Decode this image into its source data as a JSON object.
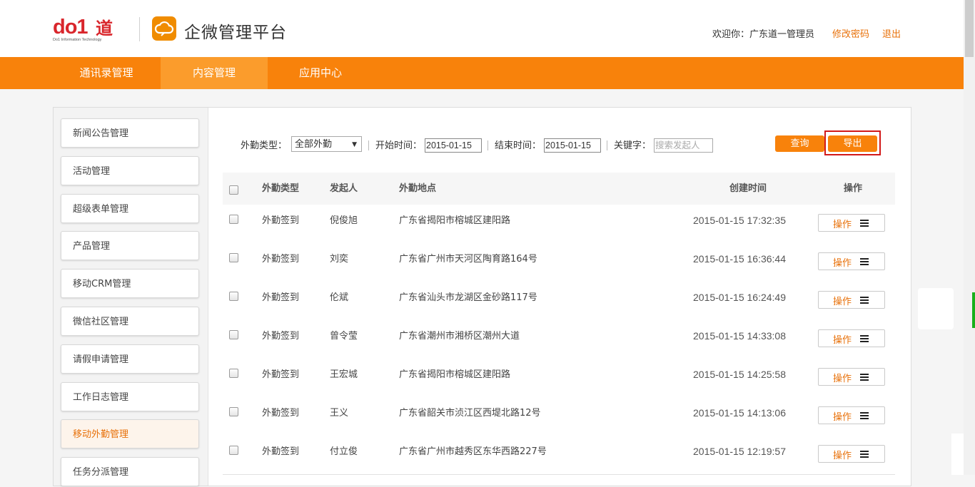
{
  "header": {
    "logo_text": "do1道",
    "logo_sub": "Do1 Information Technology",
    "app_title": "企微管理平台",
    "welcome": "欢迎你：广东道一管理员",
    "change_password": "修改密码",
    "logout": "退出"
  },
  "nav": {
    "items": [
      {
        "label": "通讯录管理"
      },
      {
        "label": "内容管理"
      },
      {
        "label": "应用中心"
      }
    ],
    "active_index": 1
  },
  "sidebar": {
    "items": [
      {
        "label": "新闻公告管理"
      },
      {
        "label": "活动管理"
      },
      {
        "label": "超级表单管理"
      },
      {
        "label": "产品管理"
      },
      {
        "label": "移动CRM管理"
      },
      {
        "label": "微信社区管理"
      },
      {
        "label": "请假申请管理"
      },
      {
        "label": "工作日志管理"
      },
      {
        "label": "移动外勤管理"
      },
      {
        "label": "任务分派管理"
      }
    ],
    "active_index": 8
  },
  "filters": {
    "type_label": "外勤类型：",
    "type_value": "全部外勤",
    "start_label": "开始时间：",
    "start_value": "2015-01-15",
    "end_label": "结束时间：",
    "end_value": "2015-01-15",
    "keyword_label": "关键字：",
    "keyword_placeholder": "搜索发起人",
    "query_button": "查询",
    "export_button": "导出"
  },
  "table": {
    "columns": [
      "外勤类型",
      "发起人",
      "外勤地点",
      "创建时间",
      "操作"
    ],
    "rows": [
      {
        "type": "外勤签到",
        "initiator": "倪俊旭",
        "location": "广东省揭阳市榕城区建阳路",
        "created": "2015-01-15 17:32:35",
        "action": "操作"
      },
      {
        "type": "外勤签到",
        "initiator": "刘奕",
        "location": "广东省广州市天河区陶育路164号",
        "created": "2015-01-15 16:36:44",
        "action": "操作"
      },
      {
        "type": "外勤签到",
        "initiator": "伦斌",
        "location": "广东省汕头市龙湖区金砂路117号",
        "created": "2015-01-15 16:24:49",
        "action": "操作"
      },
      {
        "type": "外勤签到",
        "initiator": "曾令莹",
        "location": "广东省潮州市湘桥区潮州大道",
        "created": "2015-01-15 14:33:08",
        "action": "操作"
      },
      {
        "type": "外勤签到",
        "initiator": "王宏城",
        "location": "广东省揭阳市榕城区建阳路",
        "created": "2015-01-15 14:25:58",
        "action": "操作"
      },
      {
        "type": "外勤签到",
        "initiator": "王义",
        "location": "广东省韶关市浈江区西堤北路12号",
        "created": "2015-01-15 14:13:06",
        "action": "操作"
      },
      {
        "type": "外勤签到",
        "initiator": "付立俊",
        "location": "广东省广州市越秀区东华西路227号",
        "created": "2015-01-15 12:19:57",
        "action": "操作"
      }
    ]
  },
  "colors": {
    "brand_orange": "#f8820b",
    "link_orange": "#e8710a",
    "highlight_red": "#d21919"
  }
}
